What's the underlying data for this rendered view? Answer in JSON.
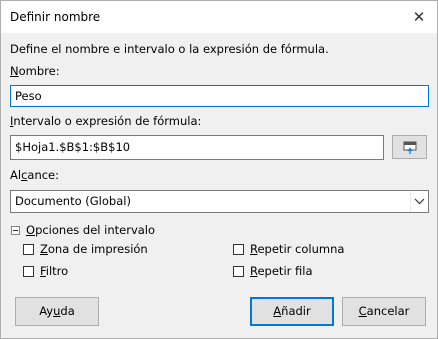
{
  "dialog": {
    "title": "Definir nombre",
    "close_icon": "close-icon"
  },
  "intro": "Define el nombre e intervalo o la expresión de fórmula.",
  "name": {
    "label_mnemonic": "N",
    "label_rest": "ombre:",
    "value": "Peso"
  },
  "range": {
    "label_mnemonic": "I",
    "label_rest": "ntervalo o expresión de fórmula:",
    "value": "$Hoja1.$B$1:$B$10",
    "shrink_button_icon": "shrink-icon"
  },
  "scope": {
    "label_pre": "Al",
    "label_mnemonic": "c",
    "label_post": "ance:",
    "selected": "Documento (Global)"
  },
  "range_options": {
    "label_mnemonic": "O",
    "label_rest": "pciones del intervalo",
    "print_range": {
      "mnemonic": "Z",
      "rest": "ona de impresión",
      "checked": false
    },
    "filter": {
      "mnemonic": "F",
      "rest": "iltro",
      "checked": false
    },
    "repeat_column": {
      "mnemonic": "R",
      "rest": "epetir columna",
      "checked": false
    },
    "repeat_row": {
      "mnemonic": "R",
      "rest": "epetir fila",
      "checked": false
    }
  },
  "buttons": {
    "help": {
      "pre": "Ay",
      "mnemonic": "u",
      "post": "da"
    },
    "add": {
      "mnemonic": "A",
      "rest": "ñadir"
    },
    "cancel": {
      "mnemonic": "C",
      "rest": "ancelar"
    }
  },
  "colors": {
    "accent": "#0078d7",
    "window_bg": "#f0f0f0",
    "button_bg": "#e1e1e1"
  }
}
